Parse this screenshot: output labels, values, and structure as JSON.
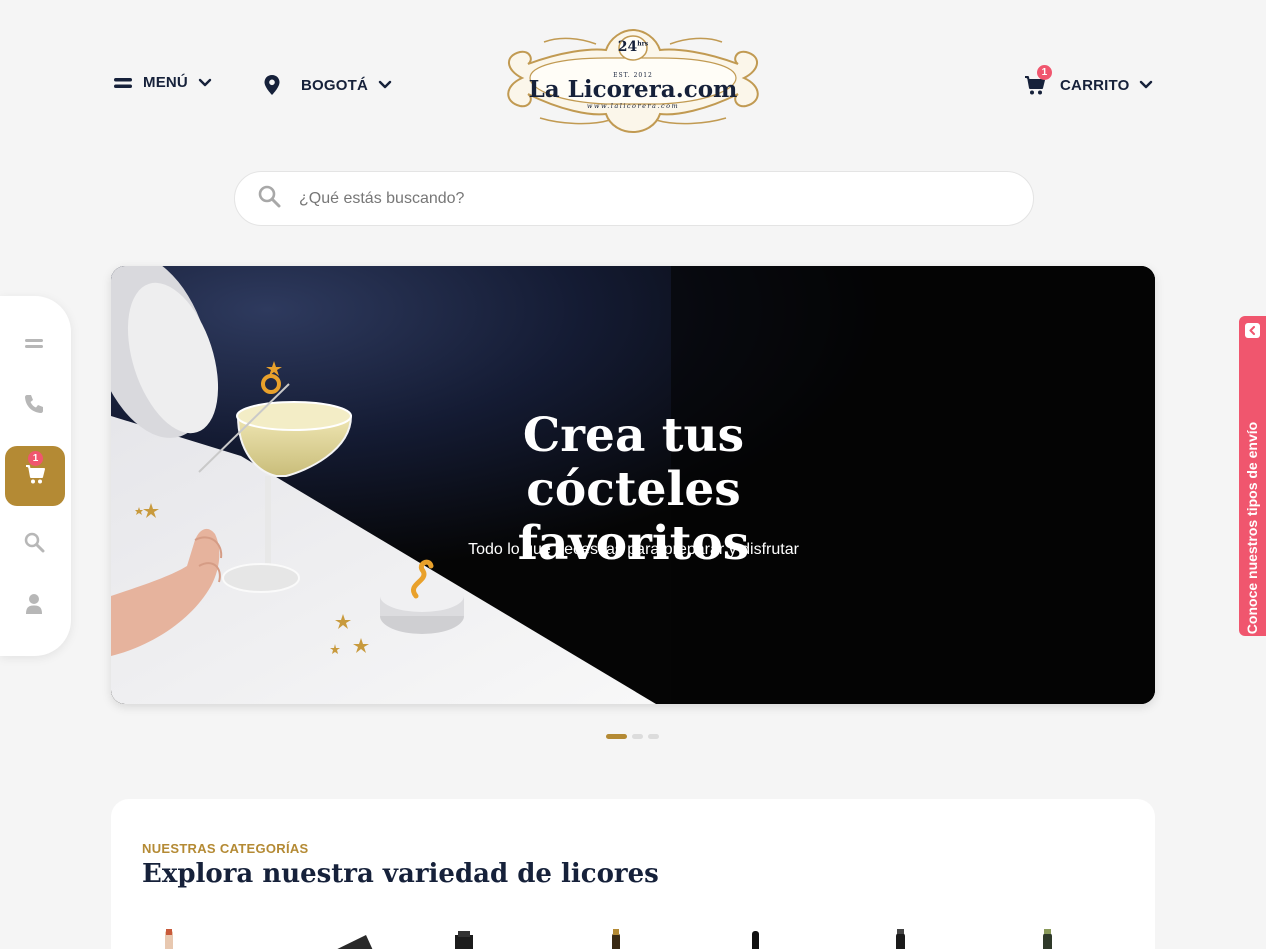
{
  "header": {
    "menu_label": "MENÚ",
    "menu_icon": "hamburger-icon",
    "city_label": "BOGOTÁ",
    "city_icon": "location-pin-icon",
    "cart_label": "CARRITO",
    "cart_icon": "cart-icon",
    "cart_count": "1"
  },
  "logo": {
    "badge": "24",
    "badge_suffix": "hrs",
    "est": "EST. 2012",
    "name": "La Licorera.com",
    "url": "www.lalicorera.com"
  },
  "search": {
    "placeholder": "¿Qué estás buscando?",
    "icon": "search-icon"
  },
  "side_rail": {
    "items": [
      "menu-icon",
      "phone-icon",
      "cart-icon",
      "search-icon",
      "user-icon"
    ],
    "cart_count": "1"
  },
  "hero": {
    "title_line1": "Crea tus cócteles",
    "title_line2": "favoritos",
    "subtitle": "Todo lo que necesitas para preparar y disfrutar",
    "slide_count": 3,
    "active_slide": 1
  },
  "shipping_tab": {
    "label": "Conoce nuestros tipos de envío"
  },
  "categories": {
    "eyebrow": "NUESTRAS CATEGORÍAS",
    "title": "Explora nuestra variedad de licores"
  },
  "colors": {
    "brand_gold": "#b48a34",
    "navy": "#16213a",
    "accent_pink": "#f0566e",
    "background": "#f5f5f5"
  }
}
